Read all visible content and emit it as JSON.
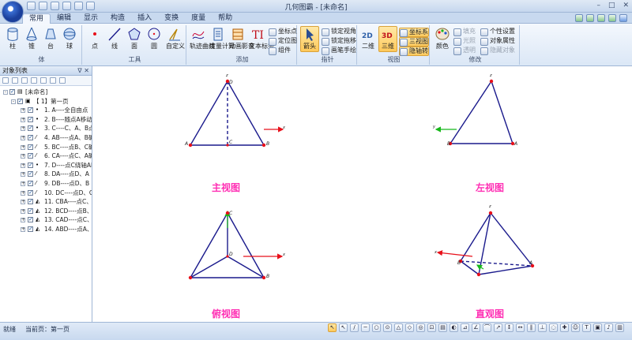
{
  "window": {
    "title": "几何图霸 - [未命名]",
    "controls": [
      "–",
      "□",
      "✕"
    ]
  },
  "ribbon": {
    "tabs": [
      {
        "label": "常用",
        "active": true
      },
      {
        "label": "编辑"
      },
      {
        "label": "显示"
      },
      {
        "label": "构造"
      },
      {
        "label": "插入"
      },
      {
        "label": "变换"
      },
      {
        "label": "度量"
      },
      {
        "label": "帮助"
      }
    ],
    "groups": {
      "solid": {
        "label": "体",
        "tools": [
          "柱",
          "锥",
          "台",
          "球"
        ]
      },
      "tools": {
        "label": "工具",
        "tools": [
          "点",
          "线",
          "面",
          "圆",
          "自定义"
        ]
      },
      "add": {
        "label": "添加",
        "tools": [
          "轨迹曲线",
          "度量计算",
          "动画影音",
          "文本标签"
        ],
        "small": [
          "坐标点",
          "定位图",
          "组件"
        ]
      },
      "pointer": {
        "label": "指针",
        "tools": [
          "箭头"
        ],
        "small": [
          "锁定视角",
          "锁定拖移",
          "画笔手绘"
        ]
      },
      "view": {
        "label": "视图",
        "tools": [
          "二维",
          "三维"
        ],
        "small": [
          "坐标系",
          "三视图",
          "隐轴转"
        ]
      },
      "modify": {
        "label": "修改",
        "tools": [
          "颜色"
        ],
        "small": [
          "填充",
          "光照",
          "透明",
          "个性设置",
          "对象属性",
          "隐藏对象"
        ]
      }
    }
  },
  "panel": {
    "title": "对象列表",
    "controls": "ᐁ ✕",
    "doc_label": "[未命名]",
    "page_label": "【 1】第一页",
    "items": [
      {
        "icon": "point",
        "text": "1. A----全自由点"
      },
      {
        "icon": "point",
        "text": "2. B----随点A移动"
      },
      {
        "icon": "point",
        "text": "3. C----C、A、B点"
      },
      {
        "icon": "line",
        "text": "4. AB----点A、B确"
      },
      {
        "icon": "line",
        "text": "5. BC----点B、C确"
      },
      {
        "icon": "line",
        "text": "6. CA----点C、A确"
      },
      {
        "icon": "point",
        "text": "7. D----点C绕轴AB"
      },
      {
        "icon": "line",
        "text": "8. DA----点D、A"
      },
      {
        "icon": "line",
        "text": "9. DB----点D、B"
      },
      {
        "icon": "line",
        "text": "10. DC----点D、C"
      },
      {
        "icon": "face",
        "text": "11. CBA----点C、B"
      },
      {
        "icon": "face",
        "text": "12. BCD----点B、C"
      },
      {
        "icon": "face",
        "text": "13. CAD----点C、A"
      },
      {
        "icon": "face",
        "text": "14. ABD----点A、B"
      }
    ]
  },
  "canvas": {
    "views": [
      {
        "id": "front",
        "caption": "主视图"
      },
      {
        "id": "left",
        "caption": "左视图"
      },
      {
        "id": "top",
        "caption": "俯视图"
      },
      {
        "id": "perspective",
        "caption": "直观图"
      }
    ],
    "point_labels": {
      "A": "A",
      "B": "B",
      "C": "C",
      "D": "D",
      "x": "x",
      "y": "y",
      "z": "z"
    },
    "colors": {
      "edge": "#1a1a8c",
      "point": "#e8101a",
      "axis_x": "#e8101a",
      "axis_y": "#16b81a",
      "caption": "#ff2fb4"
    }
  },
  "status": {
    "ready": "就绪",
    "page": "当前页：第一页",
    "tools": [
      "↖",
      "↖",
      "/",
      "─",
      "○",
      "⊙",
      "△",
      "◇",
      "◎",
      "⊡",
      "▤",
      "◐",
      "⊿",
      "∠",
      "⌒",
      "↗",
      "↕",
      "↔",
      "∥",
      "⊥",
      "◌",
      "✚",
      "☺",
      "T",
      "▣",
      "♪",
      "▥"
    ]
  }
}
